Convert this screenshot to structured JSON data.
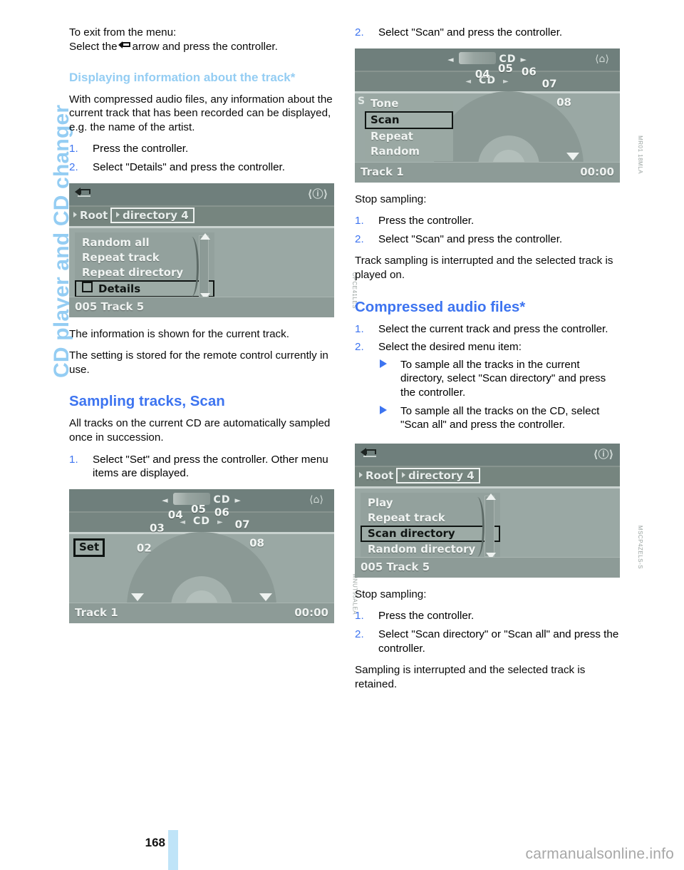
{
  "chapter_title": "CD player and CD changer",
  "page_number": "168",
  "watermark": "carmanualsonline.info",
  "left_column": {
    "intro_line1": "To exit from the menu:",
    "intro_line2_pre": "Select the",
    "intro_line2_post": "arrow and press the controller.",
    "subhead_track": "Displaying information about the track*",
    "para_compressed": "With compressed audio files, any information about the current track that has been recorded can be displayed, e.g. the name of the artist.",
    "steps_details": [
      {
        "num": "1.",
        "text": "Press the controller."
      },
      {
        "num": "2.",
        "text": "Select \"Details\" and press the controller."
      }
    ],
    "after_fig1_a": "The information is shown for the current track.",
    "after_fig1_b": "The setting is stored for the remote control currently in use.",
    "head_sampling": "Sampling tracks, Scan",
    "para_sampling": "All tracks on the current CD are automatically sampled once in succession.",
    "steps_sampling": [
      {
        "num": "1.",
        "text": "Select \"Set\" and press the controller. Other menu items are displayed."
      }
    ]
  },
  "right_column": {
    "step_scan": {
      "num": "2.",
      "text": "Select \"Scan\" and press the controller."
    },
    "stop_sampling_label": "Stop sampling:",
    "steps_stop": [
      {
        "num": "1.",
        "text": "Press the controller."
      },
      {
        "num": "2.",
        "text": "Select \"Scan\" and press the controller."
      }
    ],
    "para_interrupted": "Track sampling is interrupted and the selected track is played on.",
    "head_compressed": "Compressed audio files*",
    "steps_compressed": [
      {
        "num": "1.",
        "text": "Select the current track and press the controller."
      },
      {
        "num": "2.",
        "text": "Select the desired menu item:"
      }
    ],
    "bullets_compressed": [
      "To sample all the tracks in the current directory, select \"Scan directory\" and press the controller.",
      "To sample all the tracks on the CD, select \"Scan all\" and press the controller."
    ],
    "stop_sampling_label2": "Stop sampling:",
    "steps_stop2": [
      {
        "num": "1.",
        "text": "Press the controller."
      },
      {
        "num": "2.",
        "text": "Select \"Scan directory\" or \"Scan all\" and press the controller."
      }
    ],
    "para_retained": "Sampling is interrupted and the selected track is retained."
  },
  "figures": {
    "fig_details": {
      "breadcrumb": {
        "root": "Root",
        "current": "directory 4"
      },
      "menu_items": [
        {
          "label": "Random all",
          "selected": false,
          "checkbox": false
        },
        {
          "label": "Repeat track",
          "selected": false,
          "checkbox": false
        },
        {
          "label": "Repeat directory",
          "selected": false,
          "checkbox": false
        },
        {
          "label": "Details",
          "selected": true,
          "checkbox": true
        }
      ],
      "status": "005 Track 5",
      "code": "OPCE41LES"
    },
    "fig_set": {
      "header_source": "CD",
      "sub_source": "CD",
      "badge": "Set",
      "dial_ticks": [
        "02",
        "03",
        "04",
        "05",
        "06",
        "07",
        "08"
      ],
      "track_label": "Track 1",
      "time": "00:00",
      "code": "MNUT95ALEA"
    },
    "fig_scan": {
      "header_source": "CD",
      "sub_source": "CD",
      "badge_ghost": "S",
      "menu_items": [
        {
          "label": "Tone",
          "selected": false
        },
        {
          "label": "Scan",
          "selected": true
        },
        {
          "label": "Repeat",
          "selected": false
        },
        {
          "label": "Random",
          "selected": false
        }
      ],
      "dial_ticks": [
        "04",
        "05",
        "06",
        "07",
        "08"
      ],
      "track_label": "Track 1",
      "time": "00:00",
      "code": "MR01 18MLA"
    },
    "fig_scan_directory": {
      "breadcrumb": {
        "root": "Root",
        "current": "directory 4"
      },
      "menu_items": [
        {
          "label": "Play",
          "selected": false
        },
        {
          "label": "Repeat track",
          "selected": false
        },
        {
          "label": "Scan directory",
          "selected": true
        },
        {
          "label": "Random directory",
          "selected": false
        }
      ],
      "status": "005 Track 5",
      "code": "MSCP4ZELS-S"
    }
  },
  "colors": {
    "heading_blue": "#3d74f0",
    "subheading_blue": "#94cdf3",
    "chapter_blue": "#94cdf3",
    "page_bar": "#bfe4f8",
    "screen_bg": "#9aa8a4"
  }
}
